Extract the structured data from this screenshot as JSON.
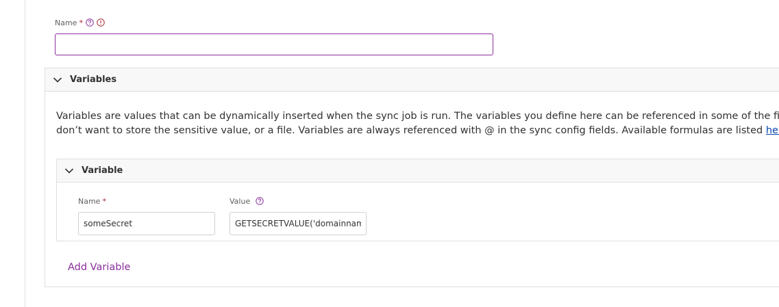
{
  "name_field": {
    "label": "Name",
    "required_mark": "*",
    "value": ""
  },
  "variables_section": {
    "title": "Variables",
    "description_line1": "Variables are values that can be dynamically inserted when the sync job is run. The variables you define here can be referenced in some of the fields in",
    "description_line2_pre": "don’t want to store the sensitive value, or a file. Variables are always referenced with @ in the sync config fields. Available formulas are listed ",
    "description_link": "here",
    "description_line2_post": "."
  },
  "variable_item": {
    "title": "Variable",
    "name_label": "Name",
    "name_required_mark": "*",
    "name_value": "someSecret",
    "value_label": "Value",
    "value_value": "GETSECRETVALUE('domainname"
  },
  "add_variable_label": "Add Variable",
  "colors": {
    "accent": "#8a2d9b",
    "required": "#a4262c",
    "link": "#0645ad",
    "header_bg": "#f8f8f8",
    "border": "#e1dfdd"
  },
  "icons": {
    "help": "question-circle-icon",
    "info": "info-circle-icon",
    "chevron": "chevron-down-icon"
  }
}
